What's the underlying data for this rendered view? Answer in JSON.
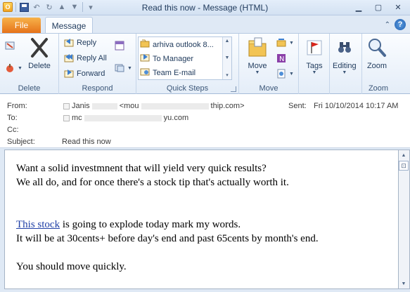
{
  "window": {
    "title": "Read this now  -  Message (HTML)",
    "controls": [
      "minimize",
      "maximize",
      "close"
    ]
  },
  "quick_access": [
    "outlook-app-icon",
    "save-icon",
    "undo-icon",
    "redo-icon",
    "up-icon",
    "down-icon",
    "customize-icon"
  ],
  "tabs": {
    "file": "File",
    "message": "Message"
  },
  "ribbon": {
    "delete_group": {
      "label": "Delete",
      "delete_button": "Delete"
    },
    "respond_group": {
      "label": "Respond",
      "reply": "Reply",
      "reply_all": "Reply All",
      "forward": "Forward"
    },
    "quick_steps_group": {
      "label": "Quick Steps",
      "items": [
        "arhiva outlook 8...",
        "To Manager",
        "Team E-mail"
      ]
    },
    "move_group": {
      "label": "Move",
      "move_button": "Move"
    },
    "tags_group": {
      "label": "",
      "tags_button": "Tags"
    },
    "editing_group": {
      "label": "",
      "editing_button": "Editing"
    },
    "zoom_group": {
      "label": "Zoom",
      "zoom_button": "Zoom"
    }
  },
  "header": {
    "from_label": "From:",
    "from_value_start": "Janis",
    "from_value_mid": "<mou",
    "from_value_end": "thip.com>",
    "to_label": "To:",
    "to_value_start": "mc",
    "to_value_end": "yu.com",
    "cc_label": "Cc:",
    "subject_label": "Subject:",
    "subject_value": "Read this now",
    "sent_label": "Sent:",
    "sent_value": "Fri 10/10/2014 10:17 AM"
  },
  "message": {
    "line1": "Want a solid investmnent that will yield very quick results?",
    "line2": "We all do, and for once there's a stock tip that's actually worth it.",
    "link_text": "This stock",
    "line3_rest": " is going to explode today mark my words.",
    "line4": "It will be at 30cents+ before day's end and past 65cents by month's end.",
    "line5": "You should move quickly."
  }
}
